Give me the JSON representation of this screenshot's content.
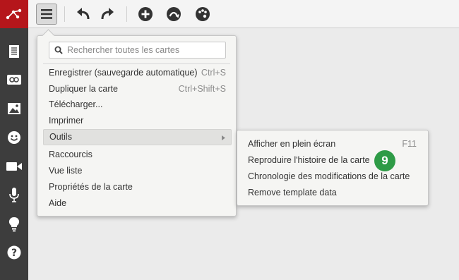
{
  "toolbar": {
    "icons": [
      "menu-icon",
      "undo-icon",
      "redo-icon",
      "add-icon",
      "connect-icon",
      "palette-icon"
    ]
  },
  "sidebar": {
    "icons": [
      "logo-icon",
      "notes-icon",
      "link-icon",
      "image-icon",
      "smiley-icon",
      "video-icon",
      "microphone-icon",
      "lightbulb-icon",
      "help-icon"
    ]
  },
  "menu": {
    "search_placeholder": "Rechercher toutes les cartes",
    "items": [
      {
        "label": "Enregistrer (sauvegarde automatique)",
        "shortcut": "Ctrl+S"
      },
      {
        "label": "Dupliquer la carte",
        "shortcut": "Ctrl+Shift+S"
      },
      {
        "label": "Télécharger...",
        "shortcut": ""
      },
      {
        "label": "Imprimer",
        "shortcut": ""
      },
      {
        "label": "Outils",
        "shortcut": ""
      },
      {
        "label": "Raccourcis",
        "shortcut": ""
      },
      {
        "label": "Vue liste",
        "shortcut": ""
      },
      {
        "label": "Propriétés de la carte",
        "shortcut": ""
      },
      {
        "label": "Aide",
        "shortcut": ""
      }
    ]
  },
  "submenu": {
    "items": [
      {
        "label": "Afficher en plein écran",
        "shortcut": "F11"
      },
      {
        "label": "Reproduire l'histoire de la carte",
        "shortcut": ""
      },
      {
        "label": "Chronologie des modifications de la carte",
        "shortcut": ""
      },
      {
        "label": "Remove template data",
        "shortcut": ""
      }
    ]
  },
  "annotation": {
    "step": "9"
  },
  "colors": {
    "brand": "#b5161b",
    "sidebar": "#3d3d3d",
    "badge": "#2e9b46"
  }
}
